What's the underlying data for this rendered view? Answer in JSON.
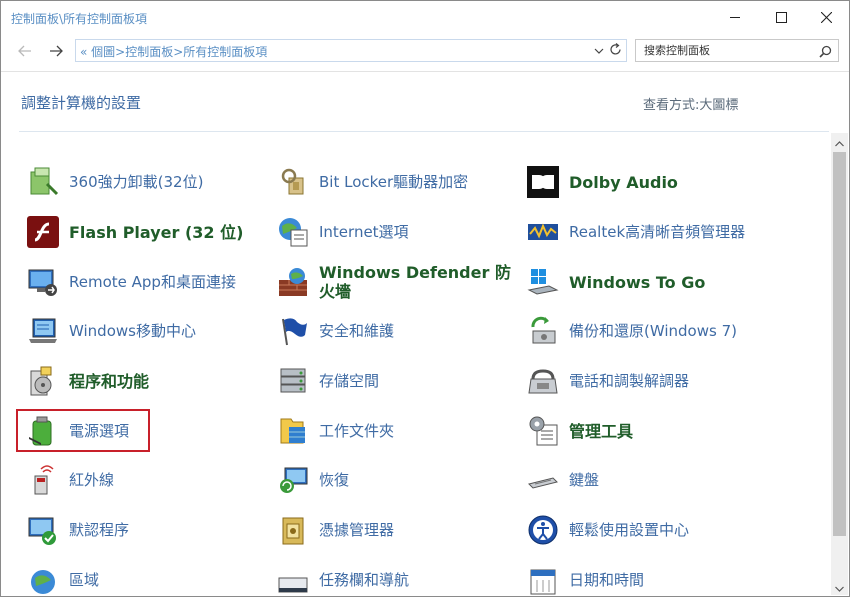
{
  "window": {
    "title": "控制面板\\所有控制面板項",
    "minimize_icon": "minimize-icon",
    "maximize_icon": "maximize-icon",
    "close_icon": "close-icon"
  },
  "nav": {
    "breadcrumb": "« 個圖>控制面板>所有控制面板項",
    "search_placeholder": "搜索控制面板"
  },
  "header": {
    "title": "調整計算機的設置",
    "view_by_label": "查看方式:",
    "view_by_value": "大圖標"
  },
  "items": [
    {
      "label": "360強力卸載(32位)",
      "icon": "uninstall-icon",
      "style": "normal"
    },
    {
      "label": "Bit Locker驅動器加密",
      "icon": "bitlocker-key-icon",
      "style": "normal"
    },
    {
      "label": "Dolby Audio",
      "icon": "dolby-icon",
      "style": "bold"
    },
    {
      "label": "Flash Player (32 位)",
      "icon": "flash-icon",
      "style": "bold"
    },
    {
      "label": "Internet選項",
      "icon": "internet-options-icon",
      "style": "normal"
    },
    {
      "label": "Realtek高清晰音頻管理器",
      "icon": "realtek-audio-icon",
      "style": "normal"
    },
    {
      "label": "Remote App和桌面連接",
      "icon": "remote-app-icon",
      "style": "normal"
    },
    {
      "label": "Windows Defender 防火墻",
      "icon": "firewall-icon",
      "style": "bold"
    },
    {
      "label": "Windows To Go",
      "icon": "windows-to-go-icon",
      "style": "bold"
    },
    {
      "label": "Windows移動中心",
      "icon": "mobility-center-icon",
      "style": "normal"
    },
    {
      "label": "安全和維護",
      "icon": "security-flag-icon",
      "style": "normal"
    },
    {
      "label": "備份和還原(Windows 7)",
      "icon": "backup-icon",
      "style": "normal"
    },
    {
      "label": "程序和功能",
      "icon": "programs-icon",
      "style": "bold"
    },
    {
      "label": "存儲空間",
      "icon": "storage-spaces-icon",
      "style": "normal"
    },
    {
      "label": "電話和調製解調器",
      "icon": "phone-modem-icon",
      "style": "normal"
    },
    {
      "label": "電源選項",
      "icon": "power-options-icon",
      "style": "normal"
    },
    {
      "label": "工作文件夾",
      "icon": "work-folders-icon",
      "style": "normal"
    },
    {
      "label": "管理工具",
      "icon": "admin-tools-icon",
      "style": "bold"
    },
    {
      "label": "紅外線",
      "icon": "infrared-icon",
      "style": "normal"
    },
    {
      "label": "恢復",
      "icon": "recovery-icon",
      "style": "normal"
    },
    {
      "label": "鍵盤",
      "icon": "keyboard-icon",
      "style": "normal"
    },
    {
      "label": "默認程序",
      "icon": "default-programs-icon",
      "style": "normal"
    },
    {
      "label": "憑據管理器",
      "icon": "credential-manager-icon",
      "style": "normal"
    },
    {
      "label": "輕鬆使用設置中心",
      "icon": "ease-of-access-icon",
      "style": "normal"
    },
    {
      "label": "區域",
      "icon": "region-icon",
      "style": "normal"
    },
    {
      "label": "任務欄和導航",
      "icon": "taskbar-icon",
      "style": "normal"
    },
    {
      "label": "日期和時間",
      "icon": "date-time-icon",
      "style": "normal"
    }
  ],
  "highlighted_item": "電源選項",
  "colors": {
    "link": "#3f6ba4",
    "bold_label": "#205d2a",
    "highlight_border": "#c8202a"
  }
}
